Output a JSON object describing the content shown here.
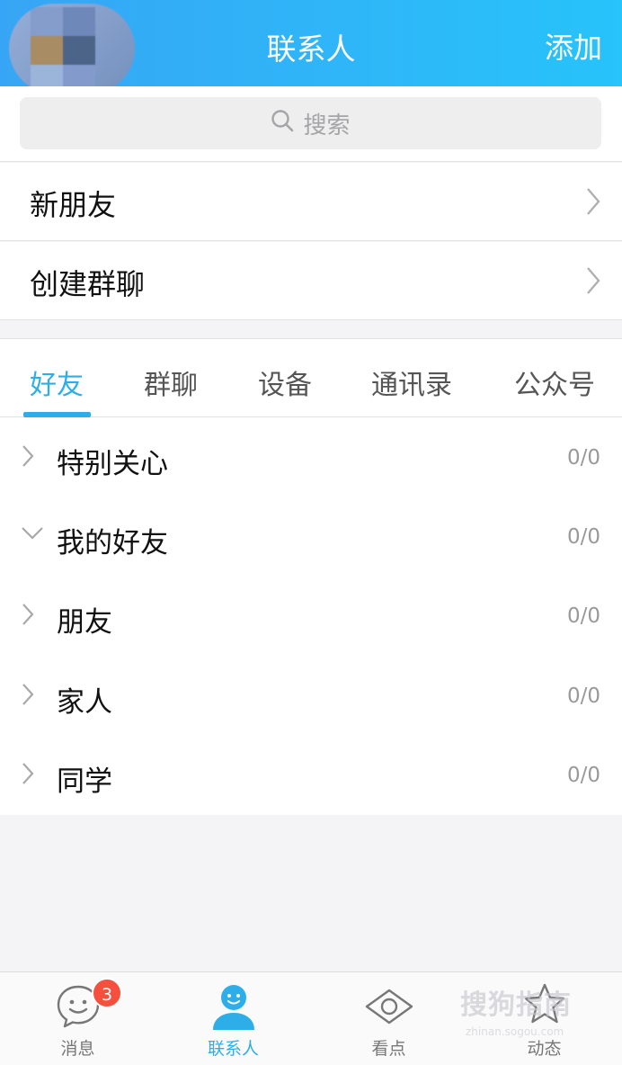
{
  "header": {
    "title": "联系人",
    "add_label": "添加"
  },
  "search": {
    "placeholder": "搜索"
  },
  "entries": [
    {
      "label": "新朋友"
    },
    {
      "label": "创建群聊"
    }
  ],
  "tabs": [
    {
      "label": "好友",
      "active": true
    },
    {
      "label": "群聊"
    },
    {
      "label": "设备"
    },
    {
      "label": "通讯录"
    },
    {
      "label": "公众号"
    }
  ],
  "groups": [
    {
      "name": "特别关心",
      "count": "0/0",
      "expanded": false
    },
    {
      "name": "我的好友",
      "count": "0/0",
      "expanded": true
    },
    {
      "name": "朋友",
      "count": "0/0",
      "expanded": false
    },
    {
      "name": "家人",
      "count": "0/0",
      "expanded": false
    },
    {
      "name": "同学",
      "count": "0/0",
      "expanded": false
    }
  ],
  "tabbar": [
    {
      "label": "消息",
      "icon": "message-icon",
      "badge": "3"
    },
    {
      "label": "联系人",
      "icon": "contacts-icon",
      "active": true
    },
    {
      "label": "看点",
      "icon": "eye-icon"
    },
    {
      "label": "动态",
      "icon": "star-icon"
    }
  ],
  "watermark": {
    "text": "搜狗指南",
    "sub": "zhinan.sogou.com"
  },
  "colors": {
    "accent": "#2eaee8",
    "header_start": "#36a5f5",
    "header_end": "#27c3fb",
    "badge": "#f5503e"
  }
}
